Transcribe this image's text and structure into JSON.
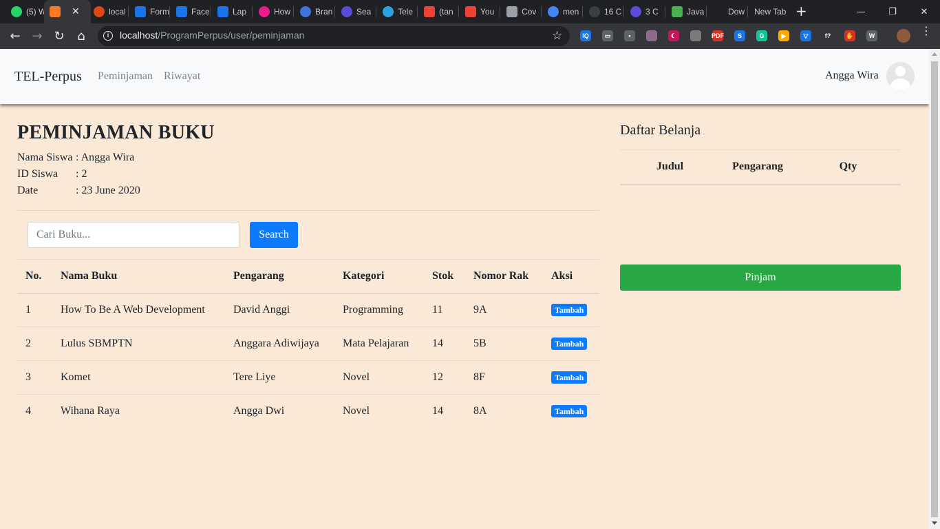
{
  "browser": {
    "tabs": [
      {
        "title": "(5) W",
        "favicon": "whatsapp-icon",
        "color": "#25d366"
      },
      {
        "title": "",
        "favicon": "xampp-icon",
        "color": "#fb7a24",
        "active": true
      },
      {
        "title": "local",
        "favicon": "codeigniter-icon",
        "color": "#dd4814"
      },
      {
        "title": "Form",
        "favicon": "flag-icon",
        "color": "#1a73e8"
      },
      {
        "title": "Face",
        "favicon": "flag-icon",
        "color": "#1a73e8"
      },
      {
        "title": "Lap",
        "favicon": "flag-icon",
        "color": "#1a73e8"
      },
      {
        "title": "How",
        "favicon": "asterisk-icon",
        "color": "#e91e8c"
      },
      {
        "title": "Bran",
        "favicon": "canva-icon",
        "color": "#3f74d8"
      },
      {
        "title": "Sea",
        "favicon": "search-icon",
        "color": "#5b4bdb"
      },
      {
        "title": "Tele",
        "favicon": "telegram-icon",
        "color": "#2aa3e0"
      },
      {
        "title": "(tan",
        "favicon": "gmail-icon",
        "color": "#ea4335"
      },
      {
        "title": "You",
        "favicon": "gmail-icon",
        "color": "#ea4335"
      },
      {
        "title": "Cov",
        "favicon": "docs-icon",
        "color": "#9aa0a6"
      },
      {
        "title": "men",
        "favicon": "google-icon",
        "color": "#4285f4"
      },
      {
        "title": "16 C",
        "favicon": "emblem-icon",
        "color": "#3c4043"
      },
      {
        "title": "3 C",
        "favicon": "db-icon",
        "color": "#5c4bdb"
      },
      {
        "title": "Java",
        "favicon": "w3-icon",
        "color": "#4caf50"
      },
      {
        "title": "Dow",
        "favicon": "download-icon",
        "color": "#202124"
      },
      {
        "title": "New Tab",
        "favicon": "",
        "color": "#202124"
      }
    ],
    "close_glyph": "✕",
    "newtab_glyph": "+",
    "win_minimize": "—",
    "win_restore": "❐",
    "win_close": "✕",
    "url_host": "localhost",
    "url_path": "/ProgramPerpus/user/peminjaman",
    "extensions": [
      {
        "name": "iq-ext-icon",
        "label": "IQ",
        "color": "#1a73e8"
      },
      {
        "name": "chat-ext-icon",
        "label": "▭",
        "color": "#5f6368"
      },
      {
        "name": "dots-ext-icon",
        "label": "•",
        "color": "#5f6368"
      },
      {
        "name": "circle-ext-icon",
        "label": "",
        "color": "#8c6b8c"
      },
      {
        "name": "moon-ext-icon",
        "label": "☾",
        "color": "#c2185b"
      },
      {
        "name": "bulb-ext-icon",
        "label": "",
        "color": "#7a7a7a"
      },
      {
        "name": "pdf-ext-icon",
        "label": "PDF",
        "color": "#d93025"
      },
      {
        "name": "s-ext-icon",
        "label": "S",
        "color": "#1a73e8"
      },
      {
        "name": "grammarly-icon",
        "label": "G",
        "color": "#15c39a"
      },
      {
        "name": "play-ext-icon",
        "label": "▶",
        "color": "#f9ab00"
      },
      {
        "name": "save-ext-icon",
        "label": "▽",
        "color": "#1a73e8"
      },
      {
        "name": "font-ext-icon",
        "label": "f?",
        "color": "#35363a"
      },
      {
        "name": "stop-ext-icon",
        "label": "✋",
        "color": "#d93025"
      },
      {
        "name": "wordpress-ext-icon",
        "label": "W",
        "color": "#5f6368"
      },
      {
        "name": "profile-ext-icon",
        "label": "",
        "color": "#8d5b3b"
      }
    ]
  },
  "navbar": {
    "brand": "TEL-Perpus",
    "links": [
      "Peminjaman",
      "Riwayat"
    ],
    "user_name": "Angga Wira"
  },
  "page": {
    "title": "PEMINJAMAN BUKU",
    "info": [
      {
        "label": "Nama Siswa",
        "value": ": Angga Wira"
      },
      {
        "label": "ID Siswa",
        "value": ": 2"
      },
      {
        "label": "Date",
        "value": ": 23 June 2020"
      }
    ],
    "search_placeholder": "Cari Buku...",
    "search_label": "Search",
    "table": {
      "headers": [
        "No.",
        "Nama Buku",
        "Pengarang",
        "Kategori",
        "Stok",
        "Nomor Rak",
        "Aksi"
      ],
      "rows": [
        [
          "1",
          "How To Be A Web Development",
          "David Anggi",
          "Programming",
          "11",
          "9A",
          "Tambah"
        ],
        [
          "2",
          "Lulus SBMPTN",
          "Anggara Adiwijaya",
          "Mata Pelajaran",
          "14",
          "5B",
          "Tambah"
        ],
        [
          "3",
          "Komet",
          "Tere Liye",
          "Novel",
          "12",
          "8F",
          "Tambah"
        ],
        [
          "4",
          "Wihana Raya",
          "Angga Dwi",
          "Novel",
          "14",
          "8A",
          "Tambah"
        ]
      ]
    }
  },
  "cart": {
    "title": "Daftar Belanja",
    "headers": [
      "Judul",
      "Pengarang",
      "Qty"
    ],
    "submit_label": "Pinjam"
  }
}
